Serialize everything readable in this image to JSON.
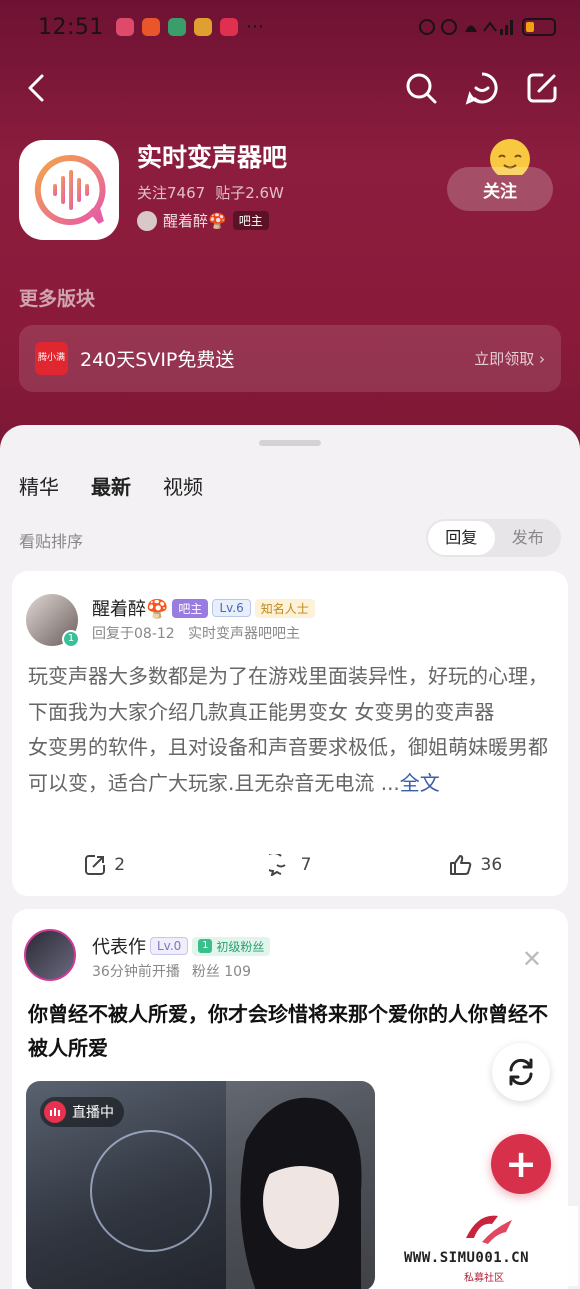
{
  "status": {
    "time": "12:51"
  },
  "forum": {
    "name": "实时变声器吧",
    "followers": "关注7467",
    "posts": "贴子2.6W",
    "owner": "醒着醉🍄",
    "owner_badge": "吧主",
    "follow_label": "关注"
  },
  "more_sections": {
    "title": "更多版块",
    "promo_logo": "腾小满",
    "promo_text": "240天SVIP免费送",
    "promo_action": "立即领取 ›"
  },
  "tabs": [
    "精华",
    "最新",
    "视频"
  ],
  "sort": {
    "label": "看贴排序",
    "options": [
      "回复",
      "发布"
    ]
  },
  "posts": [
    {
      "author": "醒着醉🍄",
      "badges": [
        "吧主",
        "Lv.6",
        "知名人士"
      ],
      "avatar_level": "1",
      "meta": "回复于08-12   实时变声器吧吧主",
      "body": "玩变声器大多数都是为了在游戏里面装异性，好玩的心理，下面我为大家介绍几款真正能男变女 女变男的变声器\n女变男的软件，且对设备和声音要求极低，御姐萌妹暖男都可以变，适合广大玩家.且无杂音无电流 ...",
      "more": "全文",
      "shares": "2",
      "comments": "7",
      "likes": "36"
    },
    {
      "author": "代表作",
      "badges": [
        "Lv.0",
        "1",
        "初级粉丝"
      ],
      "meta_time": "36分钟前开播",
      "meta_fans": "粉丝 109",
      "title": "你曾经不被人所爱，你才会珍惜将来那个爱你的人你曾经不被人所爱",
      "live_label": "直播中",
      "close": "✕"
    }
  ],
  "fab": {
    "add": "+"
  },
  "watermark": {
    "site": "WWW.SIMU001.CN",
    "sub": "私募社区"
  }
}
